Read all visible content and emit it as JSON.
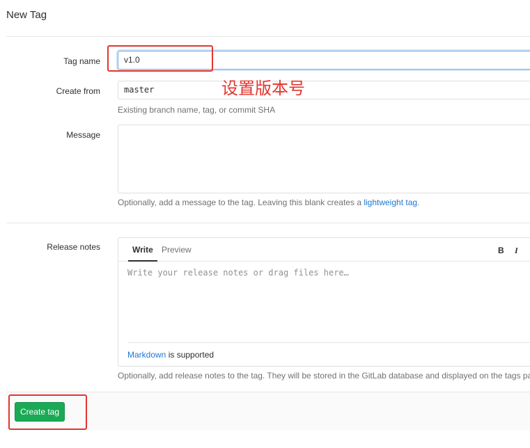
{
  "page": {
    "title": "New Tag"
  },
  "form": {
    "tag_name": {
      "label": "Tag name",
      "value": "v1.0"
    },
    "create_from": {
      "label": "Create from",
      "value": "master",
      "help": "Existing branch name, tag, or commit SHA"
    },
    "message": {
      "label": "Message",
      "help_prefix": "Optionally, add a message to the tag. Leaving this blank creates a ",
      "help_link": "lightweight tag",
      "help_suffix": "."
    },
    "release_notes": {
      "label": "Release notes",
      "tabs": [
        {
          "label": "Write",
          "active": true
        },
        {
          "label": "Preview",
          "active": false
        }
      ],
      "toolbar": {
        "bold": "B",
        "italic": "I"
      },
      "placeholder": "Write your release notes or drag files here…",
      "markdown_link": "Markdown",
      "markdown_suffix": " is supported",
      "help": "Optionally, add release notes to the tag. They will be stored in the GitLab database and displayed on the tags page."
    }
  },
  "actions": {
    "create_tag": "Create tag"
  },
  "annotation": {
    "text": "设置版本号",
    "color": "#e3352f"
  },
  "colors": {
    "primary_button": "#1aaa55",
    "link": "#1f78d1",
    "focus": "#73afea",
    "annotation": "#e3352f"
  }
}
